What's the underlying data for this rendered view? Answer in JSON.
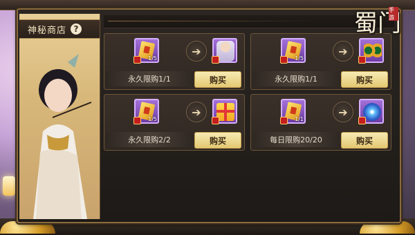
{
  "shop": {
    "title": "神秘商店",
    "help_icon": "?",
    "logo_text": "蜀门",
    "logo_seal": "手游"
  },
  "cards": [
    {
      "cost_count": "1/5",
      "limit_text": "永久限购1/1",
      "buy_label": "购买",
      "reward_icon": "character-icon"
    },
    {
      "cost_count": "1/5",
      "limit_text": "永久限购1/1",
      "buy_label": "购买",
      "reward_icon": "binocular-icon"
    },
    {
      "cost_count": "1/5",
      "limit_text": "永久限购2/2",
      "buy_label": "购买",
      "reward_icon": "gift-box-icon"
    },
    {
      "cost_count": "1/1",
      "limit_text": "每日限购20/20",
      "buy_label": "购买",
      "reward_icon": "blue-orb-icon"
    }
  ],
  "arrow_glyph": "➔"
}
